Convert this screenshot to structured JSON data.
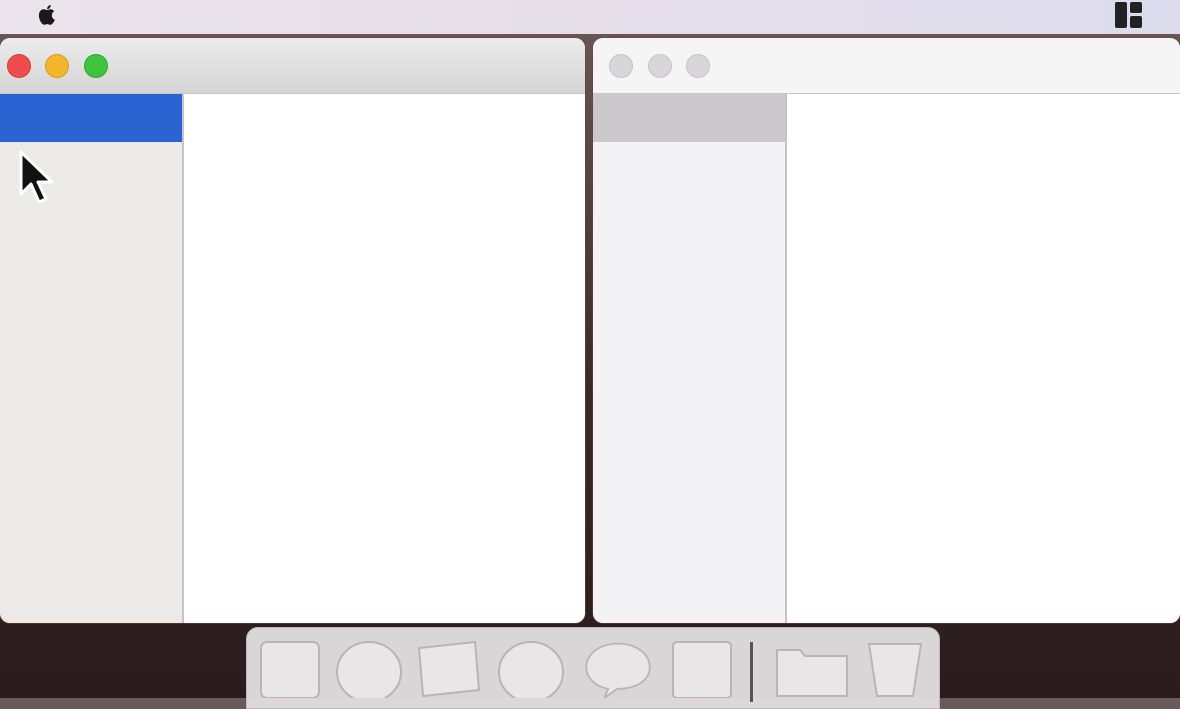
{
  "menubar": {
    "apple_icon": "apple-logo-icon",
    "right_icon": "menu-extra-icon"
  },
  "windows": [
    {
      "name": "window-left",
      "active": true,
      "traffic_lights": [
        "close",
        "minimize",
        "maximize"
      ],
      "sidebar_selected_color": "#2a64d2"
    },
    {
      "name": "window-right",
      "active": false,
      "traffic_lights": [
        "close",
        "minimize",
        "maximize"
      ],
      "sidebar_selected_color": "#cbc9cb"
    }
  ],
  "dock": {
    "items": [
      {
        "icon": "square-app-icon"
      },
      {
        "icon": "circle-app-icon"
      },
      {
        "icon": "tilted-square-app-icon"
      },
      {
        "icon": "circle-app-icon"
      },
      {
        "icon": "speech-bubble-app-icon"
      },
      {
        "icon": "square-app-icon"
      },
      {
        "icon": "folder-icon"
      },
      {
        "icon": "trash-icon"
      }
    ]
  },
  "colors": {
    "accent": "#2a64d2",
    "close": "#ed4e4b",
    "minimize": "#f5b52c",
    "maximize": "#3ec43f"
  }
}
